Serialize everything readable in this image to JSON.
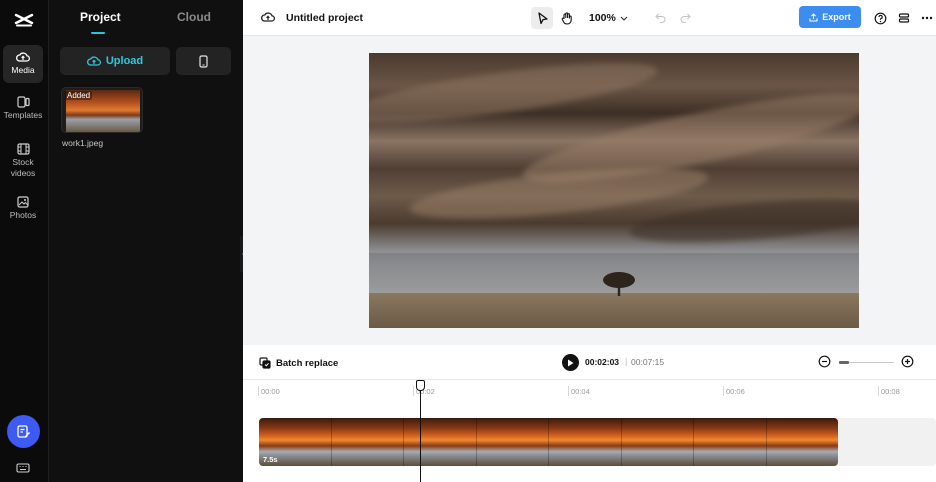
{
  "app": {
    "rail": [
      {
        "id": "media",
        "label": "Media",
        "icon": "cloud-upload-icon",
        "active": true
      },
      {
        "id": "templates",
        "label": "Templates",
        "icon": "templates-icon",
        "active": false
      },
      {
        "id": "stock",
        "label": "Stock videos",
        "icon": "film-icon",
        "active": false
      },
      {
        "id": "photos",
        "label": "Photos",
        "icon": "image-icon",
        "active": false
      }
    ]
  },
  "panel": {
    "tabs": {
      "project": "Project",
      "cloud": "Cloud"
    },
    "upload_label": "Upload",
    "asset": {
      "badge": "Added",
      "name": "work1.jpeg"
    }
  },
  "header": {
    "title": "Untitled project",
    "zoom": "100%",
    "export_label": "Export"
  },
  "timeline": {
    "batch_replace": "Batch replace",
    "current_time": "00:02:03",
    "separator": "|",
    "total_time": "00:07:15",
    "ticks": [
      "00:00",
      "00:02",
      "00:04",
      "00:06",
      "00:08"
    ],
    "clip_duration": "7.5s"
  },
  "colors": {
    "accent": "#2fc9dc",
    "export": "#3d8cf0",
    "fab": "#3d5bf2"
  }
}
